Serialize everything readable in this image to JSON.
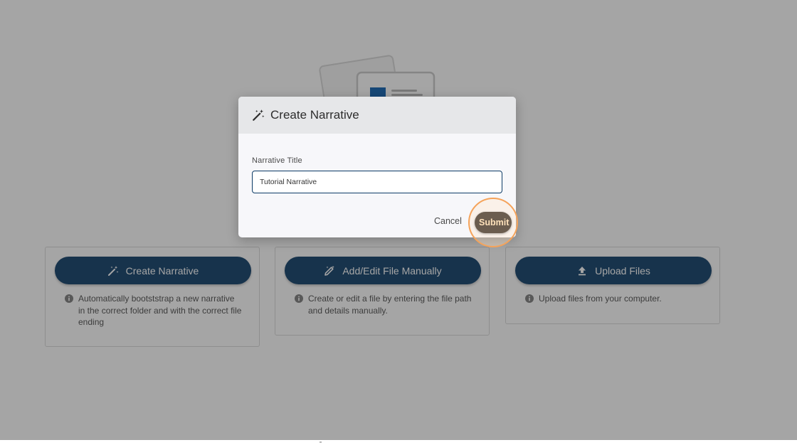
{
  "cards": [
    {
      "button_label": "Create Narrative",
      "icon": "magic-wand-icon",
      "description": "Automatically bootststrap a new narrative in the correct folder and with the correct file ending"
    },
    {
      "button_label": "Add/Edit File Manually",
      "icon": "edit-wand-icon",
      "description": "Create or edit a file by entering the file path and details manually."
    },
    {
      "button_label": "Upload Files",
      "icon": "upload-icon",
      "description": "Upload files from your computer."
    }
  ],
  "modal": {
    "title": "Create Narrative",
    "icon": "magic-wand-icon",
    "field_label": "Narrative Title",
    "field_value": "Tutorial Narrative",
    "cancel_label": "Cancel",
    "submit_label": "Submit"
  },
  "colors": {
    "primary": "#0c3b66",
    "highlight_ring": "#f5a35a",
    "submit_text": "#ffe2bb"
  }
}
